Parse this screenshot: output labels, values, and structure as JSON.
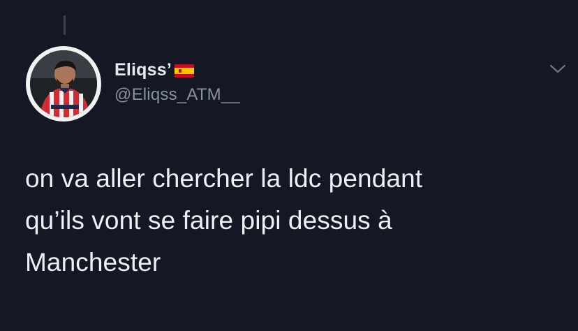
{
  "tweet": {
    "author": {
      "display_name": "Eliqss’",
      "handle": "@Eliqss_ATM__",
      "flag_icon": "spain-flag-icon",
      "avatar_icon": "profile-avatar"
    },
    "text": "on va aller chercher la ldc pendant\nqu’ils vont se faire pipi dessus à\nManchester",
    "menu_icon": "chevron-down-icon"
  },
  "colors": {
    "background": "#141824",
    "text_primary": "#eef0f3",
    "text_secondary": "#8a919c",
    "thread_line": "#3b4351"
  }
}
